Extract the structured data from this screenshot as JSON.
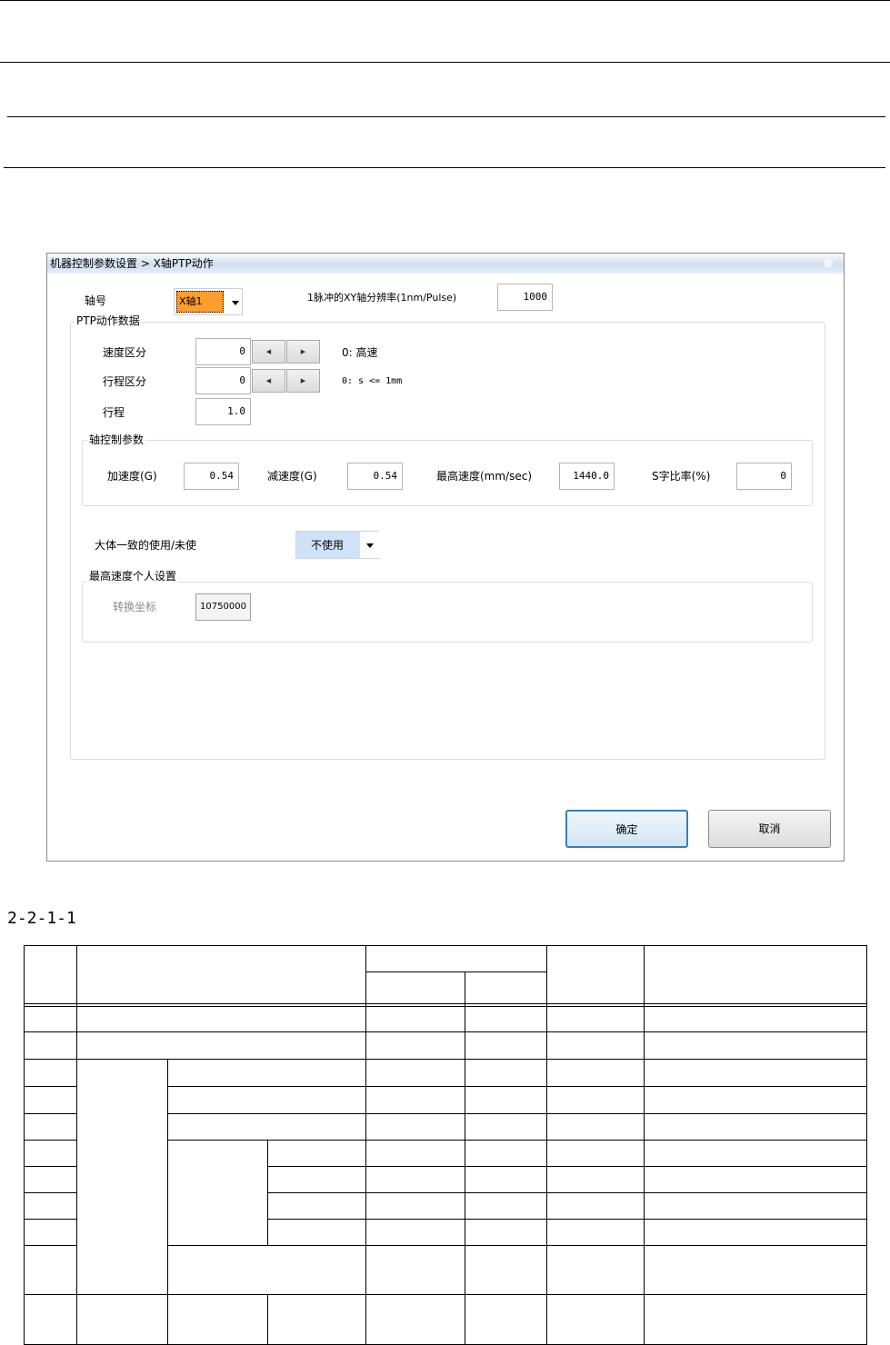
{
  "dialog": {
    "title": "机器控制参数设置 > X轴PTP动作",
    "axis_label": "轴号",
    "axis_value": "X轴1",
    "resolution_label": "1脉冲的XY轴分辨率(1nm/Pulse)",
    "resolution_value": "1000",
    "ptp_group_title": "PTP动作数据",
    "speed_class_label": "速度区分",
    "speed_class_value": "0",
    "speed_class_hint": "0: 高速",
    "stroke_class_label": "行程区分",
    "stroke_class_value": "0",
    "stroke_class_hint": "0: s <= 1mm",
    "stroke_label": "行程",
    "stroke_value": "1.0",
    "axis_ctrl_group_title": "轴控制参数",
    "accel_label": "加速度(G)",
    "accel_value": "0.54",
    "decel_label": "减速度(G)",
    "decel_value": "0.54",
    "max_speed_label": "最高速度(mm/sec)",
    "max_speed_value": "1440.0",
    "s_ratio_label": "S字比率(%)",
    "s_ratio_value": "0",
    "rough_use_label": "大体一致的使用/未使",
    "rough_use_value": "不使用",
    "max_speed_personal_title": "最高速度个人设置",
    "convert_coord_label": "转换坐标",
    "convert_coord_value": "10750000",
    "ok_label": "确定",
    "cancel_label": "取消"
  },
  "caption": "2-2-1-1",
  "colors": {
    "axis_select": "#ff9d2e",
    "combo_blue": "#cfe2f8",
    "ok_border": "#3c7fb1"
  },
  "icons": [
    "dropdown-arrow-icon",
    "spin-left-icon",
    "spin-right-icon"
  ]
}
